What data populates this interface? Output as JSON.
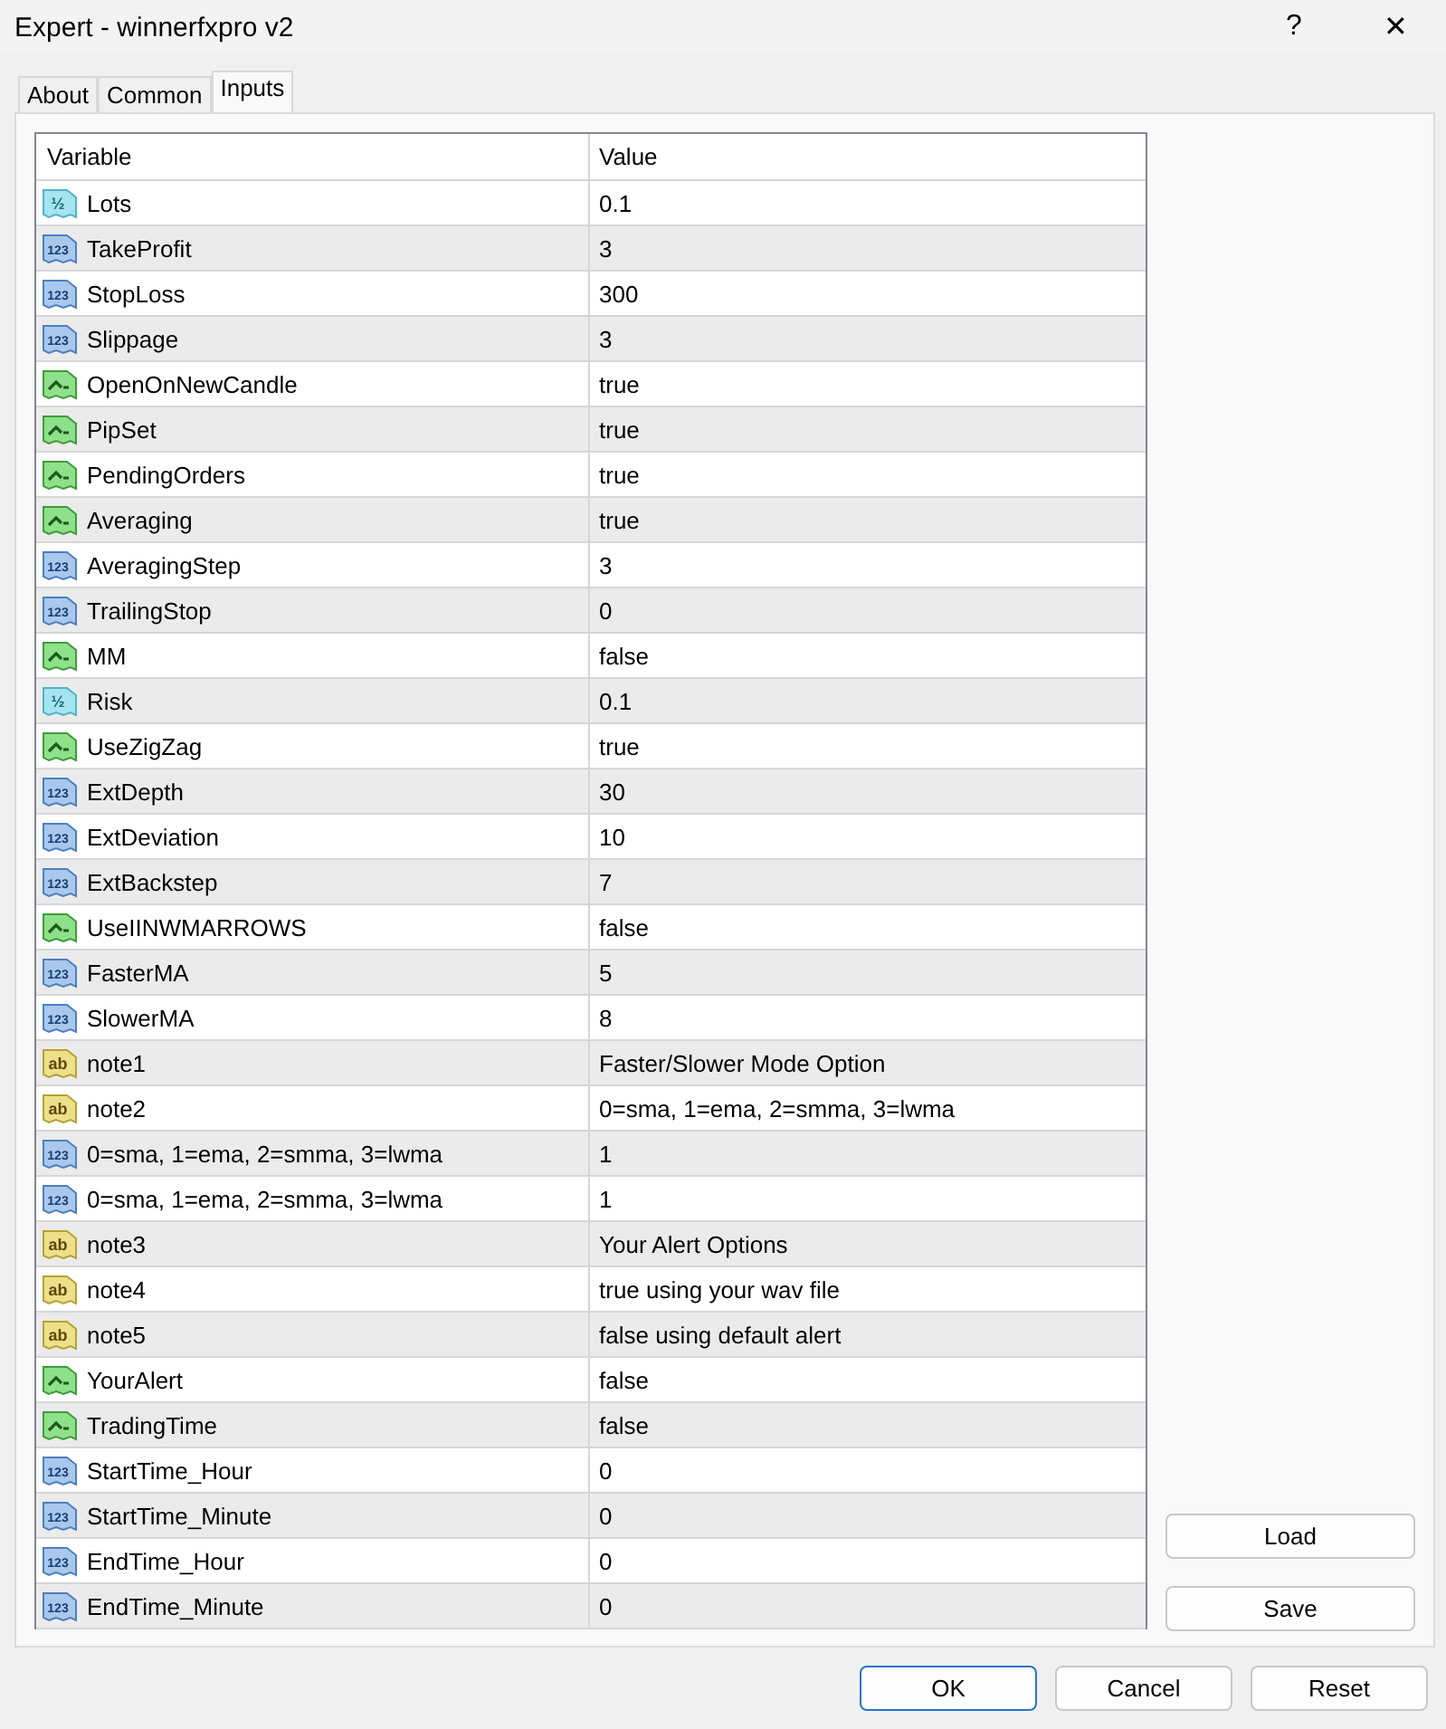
{
  "window": {
    "title": "Expert - winnerfxpro v2",
    "buttons": [
      "?",
      "✕"
    ]
  },
  "tabs": [
    {
      "label": "About",
      "selected": false
    },
    {
      "label": "Common",
      "selected": false
    },
    {
      "label": "Inputs",
      "selected": true
    }
  ],
  "table": {
    "columns": [
      "Variable",
      "Value"
    ],
    "rows": [
      {
        "kind": "double",
        "badge": "½",
        "name": "Lots",
        "value": "0.1"
      },
      {
        "kind": "int",
        "badge": "123",
        "name": "TakeProfit",
        "value": "3"
      },
      {
        "kind": "int",
        "badge": "123",
        "name": "StopLoss",
        "value": "300"
      },
      {
        "kind": "int",
        "badge": "123",
        "name": "Slippage",
        "value": "3"
      },
      {
        "kind": "bool",
        "name": "OpenOnNewCandle",
        "value": "true"
      },
      {
        "kind": "bool",
        "name": "PipSet",
        "value": "true"
      },
      {
        "kind": "bool",
        "name": "PendingOrders",
        "value": "true"
      },
      {
        "kind": "bool",
        "name": "Averaging",
        "value": "true"
      },
      {
        "kind": "int",
        "badge": "123",
        "name": "AveragingStep",
        "value": "3"
      },
      {
        "kind": "int",
        "badge": "123",
        "name": "TrailingStop",
        "value": "0"
      },
      {
        "kind": "bool",
        "name": "MM",
        "value": "false"
      },
      {
        "kind": "double",
        "badge": "½",
        "name": "Risk",
        "value": "0.1"
      },
      {
        "kind": "bool",
        "name": "UseZigZag",
        "value": "true"
      },
      {
        "kind": "int",
        "badge": "123",
        "name": "ExtDepth",
        "value": "30"
      },
      {
        "kind": "int",
        "badge": "123",
        "name": "ExtDeviation",
        "value": "10"
      },
      {
        "kind": "int",
        "badge": "123",
        "name": "ExtBackstep",
        "value": "7"
      },
      {
        "kind": "bool",
        "name": "UseIINWMARROWS",
        "value": "false"
      },
      {
        "kind": "int",
        "badge": "123",
        "name": "FasterMA",
        "value": "5"
      },
      {
        "kind": "int",
        "badge": "123",
        "name": "SlowerMA",
        "value": "8"
      },
      {
        "kind": "string",
        "badge": "ab",
        "name": "note1",
        "value": "Faster/Slower Mode Option"
      },
      {
        "kind": "string",
        "badge": "ab",
        "name": "note2",
        "value": "0=sma, 1=ema, 2=smma, 3=lwma"
      },
      {
        "kind": "int",
        "badge": "123",
        "name": "0=sma, 1=ema, 2=smma, 3=lwma",
        "value": "1"
      },
      {
        "kind": "int",
        "badge": "123",
        "name": "0=sma, 1=ema, 2=smma, 3=lwma",
        "value": "1"
      },
      {
        "kind": "string",
        "badge": "ab",
        "name": "note3",
        "value": "Your Alert Options"
      },
      {
        "kind": "string",
        "badge": "ab",
        "name": "note4",
        "value": "true using your wav file"
      },
      {
        "kind": "string",
        "badge": "ab",
        "name": "note5",
        "value": "false using default alert"
      },
      {
        "kind": "bool",
        "name": "YourAlert",
        "value": "false"
      },
      {
        "kind": "bool",
        "name": "TradingTime",
        "value": "false"
      },
      {
        "kind": "int",
        "badge": "123",
        "name": "StartTime_Hour",
        "value": "0"
      },
      {
        "kind": "int",
        "badge": "123",
        "name": "StartTime_Minute",
        "value": "0"
      },
      {
        "kind": "int",
        "badge": "123",
        "name": "EndTime_Hour",
        "value": "0"
      },
      {
        "kind": "int",
        "badge": "123",
        "name": "EndTime_Minute",
        "value": "0"
      }
    ]
  },
  "side_buttons": [
    "Load",
    "Save"
  ],
  "buttons": [
    "OK",
    "Cancel",
    "Reset"
  ]
}
